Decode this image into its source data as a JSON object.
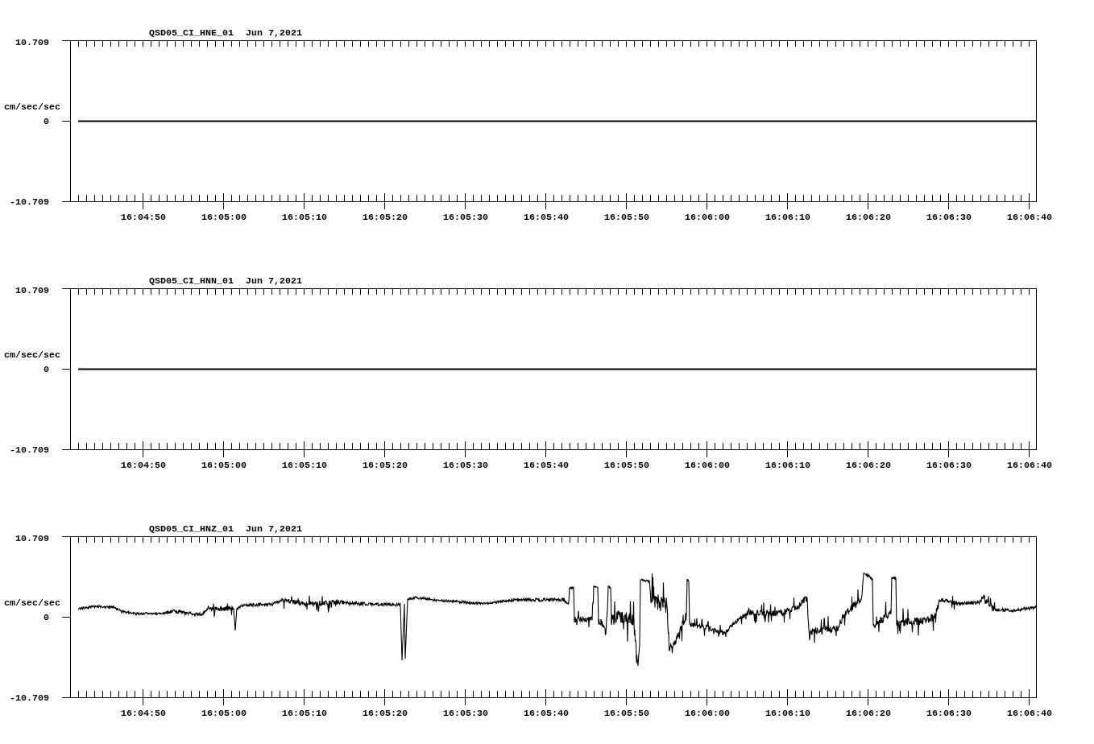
{
  "panels": [
    {
      "channel": "QSD05_CI_HNE_01",
      "date": "Jun 7,2021",
      "unit": "cm/sec/sec",
      "y_labels": [
        "10.709",
        "0",
        "-10.709"
      ],
      "x_ticks": [
        "16:04:50",
        "16:05:00",
        "16:05:10",
        "16:05:20",
        "16:05:30",
        "16:05:40",
        "16:05:50",
        "16:06:00",
        "16:06:10",
        "16:06:20",
        "16:06:30",
        "16:06:40"
      ],
      "kind": "flat"
    },
    {
      "channel": "QSD05_CI_HNN_01",
      "date": "Jun 7,2021",
      "unit": "cm/sec/sec",
      "y_labels": [
        "10.709",
        "0",
        "-10.709"
      ],
      "x_ticks": [
        "16:04:50",
        "16:05:00",
        "16:05:10",
        "16:05:20",
        "16:05:30",
        "16:05:40",
        "16:05:50",
        "16:06:00",
        "16:06:10",
        "16:06:20",
        "16:06:30",
        "16:06:40"
      ],
      "kind": "flat"
    },
    {
      "channel": "QSD05_CI_HNZ_01",
      "date": "Jun 7,2021",
      "unit": "cm/sec/sec",
      "y_labels": [
        "10.709",
        "0",
        "-10.709"
      ],
      "x_ticks": [
        "16:04:50",
        "16:05:00",
        "16:05:10",
        "16:05:20",
        "16:05:30",
        "16:05:40",
        "16:05:50",
        "16:06:00",
        "16:06:10",
        "16:06:20",
        "16:06:30",
        "16:06:40"
      ],
      "kind": "waveform"
    }
  ]
}
